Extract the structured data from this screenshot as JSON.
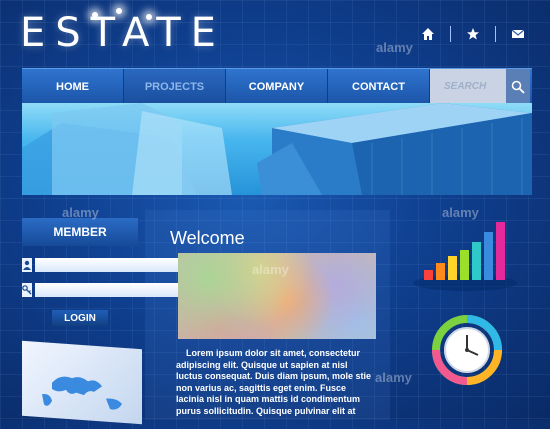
{
  "header": {
    "logo": "ESTATE"
  },
  "top_icons": [
    {
      "name": "home-icon"
    },
    {
      "name": "star-icon"
    },
    {
      "name": "mail-icon"
    }
  ],
  "nav": {
    "items": [
      {
        "label": "HOME",
        "active": false
      },
      {
        "label": "PROJECTS",
        "active": true
      },
      {
        "label": "COMPANY",
        "active": false
      },
      {
        "label": "CONTACT",
        "active": false
      }
    ],
    "search_placeholder": "SEARCH"
  },
  "member": {
    "title": "MEMBER",
    "login_label": "LOGIN"
  },
  "main": {
    "welcome": "Welcome",
    "body": "Lorem ipsum dolor sit amet, consectetur adipiscing elit. Quisque ut sapien at nisl luctus consequat. Duis diam ipsum, mole stie non varius ac, sagittis eget enim. Fusce lacinia nisl in quam mattis id condimentum purus sollicitudin. Quisque pulvinar elit at"
  },
  "colors": {
    "background": "#0f3f8f",
    "nav": "#1b55a8",
    "accent": "#48b6ee"
  },
  "watermark": "alamy"
}
